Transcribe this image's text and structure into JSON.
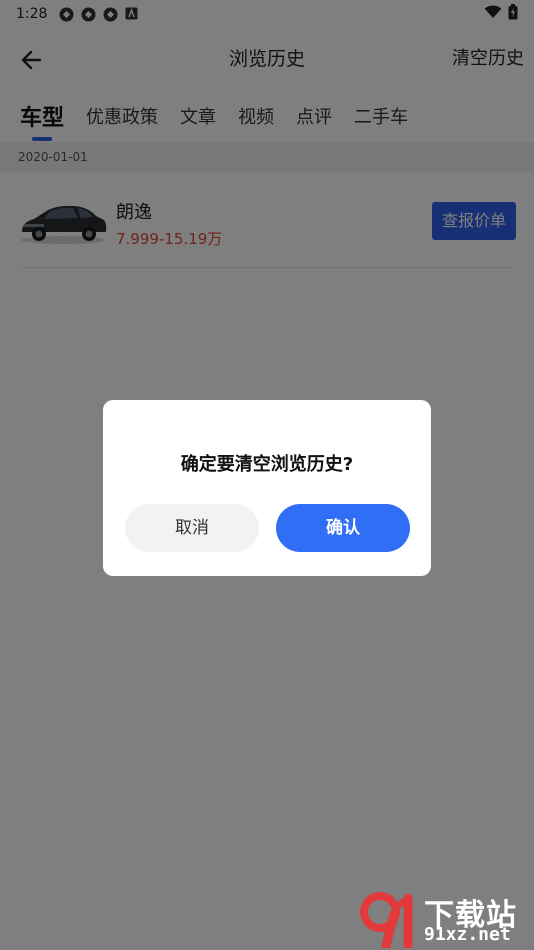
{
  "status_bar": {
    "time": "1:28",
    "icons_left": [
      "app-icon",
      "app-icon",
      "app-icon",
      "notification-icon"
    ],
    "icons_right": [
      "wifi-icon",
      "battery-icon"
    ]
  },
  "header": {
    "title": "浏览历史",
    "clear_label": "清空历史",
    "back_icon": "arrow-left-icon"
  },
  "tabs": [
    {
      "label": "车型",
      "active": true
    },
    {
      "label": "优惠政策",
      "active": false
    },
    {
      "label": "文章",
      "active": false
    },
    {
      "label": "视频",
      "active": false
    },
    {
      "label": "点评",
      "active": false
    },
    {
      "label": "二手车",
      "active": false
    }
  ],
  "history": {
    "date": "2020-01-01",
    "items": [
      {
        "name": "朗逸",
        "price": "7.999-15.19万",
        "button_label": "查报价单"
      }
    ]
  },
  "dialog": {
    "message": "确定要清空浏览历史?",
    "cancel_label": "取消",
    "confirm_label": "确认"
  },
  "watermark": {
    "title": "下载站",
    "site": "91xz.net"
  },
  "colors": {
    "accent": "#2f5ee8",
    "confirm": "#2f6ef5",
    "price": "#e2463b",
    "overlay": "rgba(0,0,0,0.5)"
  }
}
